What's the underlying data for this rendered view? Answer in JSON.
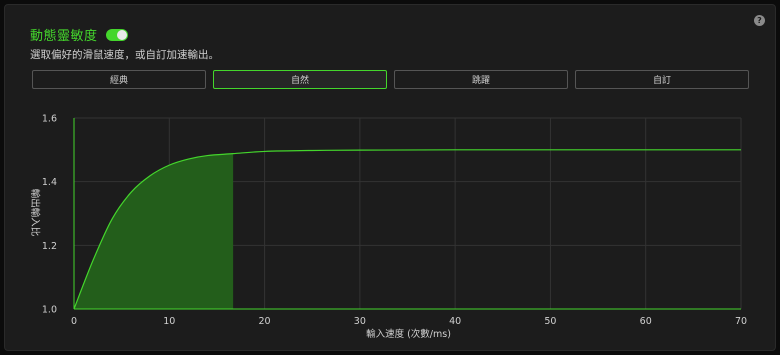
{
  "header": {
    "title": "動態靈敏度",
    "toggle_on": true,
    "help_icon": "?",
    "description": "選取偏好的滑鼠速度，或自訂加速輸出。"
  },
  "presets": [
    {
      "label": "經典",
      "active": false
    },
    {
      "label": "自然",
      "active": true
    },
    {
      "label": "跳躍",
      "active": false
    },
    {
      "label": "自訂",
      "active": false
    }
  ],
  "colors": {
    "accent": "#44d62c",
    "fill": "#235e1b",
    "grid": "#333333"
  },
  "chart_data": {
    "type": "area",
    "xlabel": "輸入速度 (次數/ms)",
    "ylabel": "輸出輸入比",
    "xlim": [
      0,
      70
    ],
    "ylim": [
      1.0,
      1.6
    ],
    "xticks": [
      0,
      10,
      20,
      30,
      40,
      50,
      60,
      70
    ],
    "yticks": [
      1.0,
      1.2,
      1.4,
      1.6
    ],
    "ytick_labels": [
      "1.0",
      "1.2",
      "1.4",
      "1.6"
    ],
    "series": [
      {
        "x": [
          0,
          2,
          4,
          6,
          8,
          10,
          12,
          14,
          16.7,
          20,
          25,
          30,
          40,
          50,
          60,
          70
        ],
        "y": [
          1.0,
          1.153,
          1.283,
          1.367,
          1.419,
          1.452,
          1.471,
          1.482,
          1.488,
          1.495,
          1.498,
          1.499,
          1.5,
          1.5,
          1.5,
          1.5
        ]
      }
    ],
    "filled_until_x": 16.7
  }
}
